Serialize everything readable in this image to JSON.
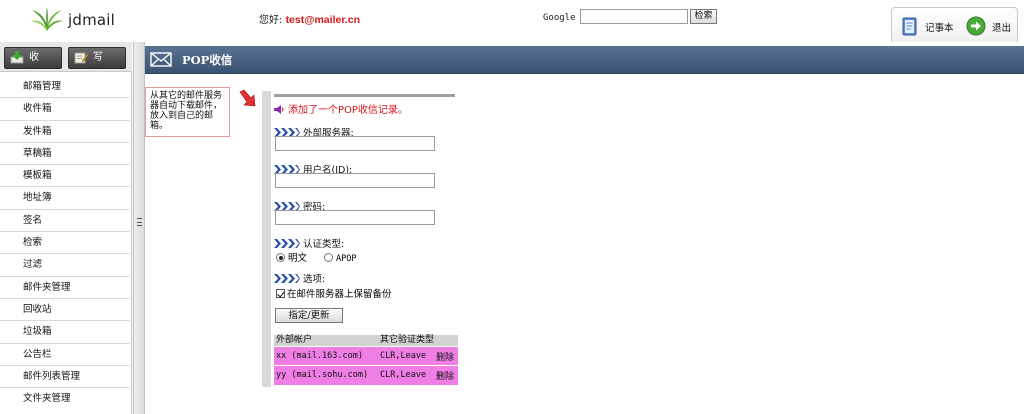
{
  "header": {
    "app_name": "jdmail",
    "greeting_label": "您好:",
    "user_email": "test@mailer.cn",
    "search": {
      "label": "Google",
      "value": "",
      "button_label": "检索"
    },
    "tools": {
      "notepad_label": "记事本",
      "logout_label": "退出"
    }
  },
  "sidebar": {
    "tabs": {
      "inbox_label": "收 信",
      "compose_label": "写 信"
    },
    "items": [
      "邮箱管理",
      "收件箱",
      "发件箱",
      "草稿箱",
      "模板箱",
      "地址簿",
      "签名",
      "检索",
      "过滤",
      "邮件夹管理",
      "回收站",
      "垃圾箱",
      "公告栏",
      "邮件列表管理",
      "文件夹管理"
    ]
  },
  "main": {
    "title": "POP收信",
    "help_text": "从其它的邮件服务器自动下载邮件，放入到自己的邮箱。",
    "notice": "添加了一个POP收信记录。",
    "fields": {
      "server_label": "外部服务器:",
      "server_value": "",
      "username_label": "用户名(ID):",
      "username_value": "",
      "password_label": "密码:",
      "password_value": "",
      "auth_label": "认证类型:",
      "auth_options": [
        "明文",
        "APOP"
      ],
      "options_label": "选项:",
      "keep_copy_label": "在邮件服务器上保留备份"
    },
    "submit_label": "指定/更新",
    "table": {
      "headers": [
        "外部帐户",
        "其它验证类型"
      ],
      "rows": [
        {
          "account": "xx (mail.163.com)",
          "type": "CLR,Leave",
          "action": "删除"
        },
        {
          "account": "yy (mail.sohu.com)",
          "type": "CLR,Leave",
          "action": "删除"
        }
      ]
    }
  },
  "colors": {
    "title_bar": "#4a6384",
    "notice_text": "#d9161b",
    "email_text": "#d9161b",
    "row_highlight": "#ef7ee5",
    "chevron": "#2a4fa8"
  }
}
